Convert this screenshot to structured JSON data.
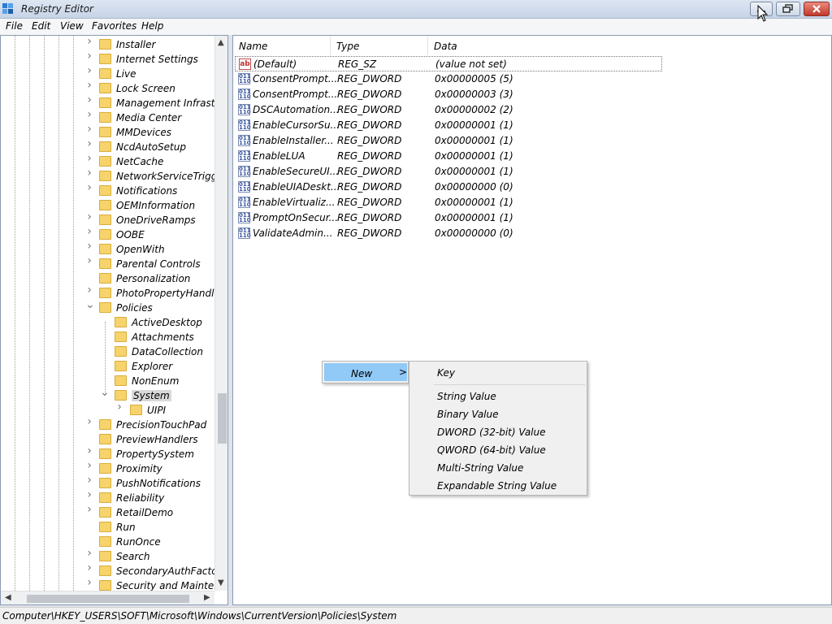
{
  "window": {
    "title": "Registry Editor"
  },
  "menubar": [
    "File",
    "Edit",
    "View",
    "Favorites",
    "Help"
  ],
  "tree": {
    "items": [
      {
        "label": "Installer",
        "depth": 0,
        "expander": "right"
      },
      {
        "label": "Internet Settings",
        "depth": 0,
        "expander": "right"
      },
      {
        "label": "Live",
        "depth": 0,
        "expander": "right"
      },
      {
        "label": "Lock Screen",
        "depth": 0,
        "expander": "right"
      },
      {
        "label": "Management Infrastruc",
        "depth": 0,
        "expander": "right"
      },
      {
        "label": "Media Center",
        "depth": 0,
        "expander": "right"
      },
      {
        "label": "MMDevices",
        "depth": 0,
        "expander": "right"
      },
      {
        "label": "NcdAutoSetup",
        "depth": 0,
        "expander": "right"
      },
      {
        "label": "NetCache",
        "depth": 0,
        "expander": "right"
      },
      {
        "label": "NetworkServiceTriggers",
        "depth": 0,
        "expander": "right"
      },
      {
        "label": "Notifications",
        "depth": 0,
        "expander": "right"
      },
      {
        "label": "OEMInformation",
        "depth": 0,
        "expander": "none"
      },
      {
        "label": "OneDriveRamps",
        "depth": 0,
        "expander": "right"
      },
      {
        "label": "OOBE",
        "depth": 0,
        "expander": "right"
      },
      {
        "label": "OpenWith",
        "depth": 0,
        "expander": "right"
      },
      {
        "label": "Parental Controls",
        "depth": 0,
        "expander": "right"
      },
      {
        "label": "Personalization",
        "depth": 0,
        "expander": "none"
      },
      {
        "label": "PhotoPropertyHandler",
        "depth": 0,
        "expander": "right"
      },
      {
        "label": "Policies",
        "depth": 0,
        "expander": "down"
      },
      {
        "label": "ActiveDesktop",
        "depth": 1,
        "expander": "none"
      },
      {
        "label": "Attachments",
        "depth": 1,
        "expander": "none"
      },
      {
        "label": "DataCollection",
        "depth": 1,
        "expander": "none"
      },
      {
        "label": "Explorer",
        "depth": 1,
        "expander": "none"
      },
      {
        "label": "NonEnum",
        "depth": 1,
        "expander": "none"
      },
      {
        "label": "System",
        "depth": 1,
        "expander": "down",
        "selected": true
      },
      {
        "label": "UIPI",
        "depth": 2,
        "expander": "right"
      },
      {
        "label": "PrecisionTouchPad",
        "depth": 0,
        "expander": "right"
      },
      {
        "label": "PreviewHandlers",
        "depth": 0,
        "expander": "none"
      },
      {
        "label": "PropertySystem",
        "depth": 0,
        "expander": "right"
      },
      {
        "label": "Proximity",
        "depth": 0,
        "expander": "right"
      },
      {
        "label": "PushNotifications",
        "depth": 0,
        "expander": "right"
      },
      {
        "label": "Reliability",
        "depth": 0,
        "expander": "right"
      },
      {
        "label": "RetailDemo",
        "depth": 0,
        "expander": "right"
      },
      {
        "label": "Run",
        "depth": 0,
        "expander": "none"
      },
      {
        "label": "RunOnce",
        "depth": 0,
        "expander": "none"
      },
      {
        "label": "Search",
        "depth": 0,
        "expander": "right"
      },
      {
        "label": "SecondaryAuthFactor",
        "depth": 0,
        "expander": "right"
      },
      {
        "label": "Security and Maintenar",
        "depth": 0,
        "expander": "right"
      }
    ]
  },
  "list": {
    "columns": [
      "Name",
      "Type",
      "Data"
    ],
    "rows": [
      {
        "icon": "string-value-icon",
        "name": "(Default)",
        "type": "REG_SZ",
        "data": "(value not set)"
      },
      {
        "icon": "dword-value-icon",
        "name": "ConsentPrompt...",
        "type": "REG_DWORD",
        "data": "0x00000005 (5)"
      },
      {
        "icon": "dword-value-icon",
        "name": "ConsentPrompt...",
        "type": "REG_DWORD",
        "data": "0x00000003 (3)"
      },
      {
        "icon": "dword-value-icon",
        "name": "DSCAutomation...",
        "type": "REG_DWORD",
        "data": "0x00000002 (2)"
      },
      {
        "icon": "dword-value-icon",
        "name": "EnableCursorSu...",
        "type": "REG_DWORD",
        "data": "0x00000001 (1)"
      },
      {
        "icon": "dword-value-icon",
        "name": "EnableInstaller...",
        "type": "REG_DWORD",
        "data": "0x00000001 (1)"
      },
      {
        "icon": "dword-value-icon",
        "name": "EnableLUA",
        "type": "REG_DWORD",
        "data": "0x00000001 (1)"
      },
      {
        "icon": "dword-value-icon",
        "name": "EnableSecureUI...",
        "type": "REG_DWORD",
        "data": "0x00000001 (1)"
      },
      {
        "icon": "dword-value-icon",
        "name": "EnableUIADeskt...",
        "type": "REG_DWORD",
        "data": "0x00000000 (0)"
      },
      {
        "icon": "dword-value-icon",
        "name": "EnableVirtualiz...",
        "type": "REG_DWORD",
        "data": "0x00000001 (1)"
      },
      {
        "icon": "dword-value-icon",
        "name": "PromptOnSecur...",
        "type": "REG_DWORD",
        "data": "0x00000001 (1)"
      },
      {
        "icon": "dword-value-icon",
        "name": "ValidateAdmin...",
        "type": "REG_DWORD",
        "data": "0x00000000 (0)"
      }
    ]
  },
  "context_menu": {
    "new_label": "New",
    "submenu_arrow": ">",
    "submenu": [
      "Key",
      "String Value",
      "Binary Value",
      "DWORD (32-bit) Value",
      "QWORD (64-bit) Value",
      "Multi-String Value",
      "Expandable String Value"
    ]
  },
  "statusbar": {
    "path": "Computer\\HKEY_USERS\\SOFT\\Microsoft\\Windows\\CurrentVersion\\Policies\\System"
  },
  "colors": {
    "selection": "#91c9f7",
    "folder": "#f6d36b",
    "tree_selected": "#d9d9d9"
  }
}
